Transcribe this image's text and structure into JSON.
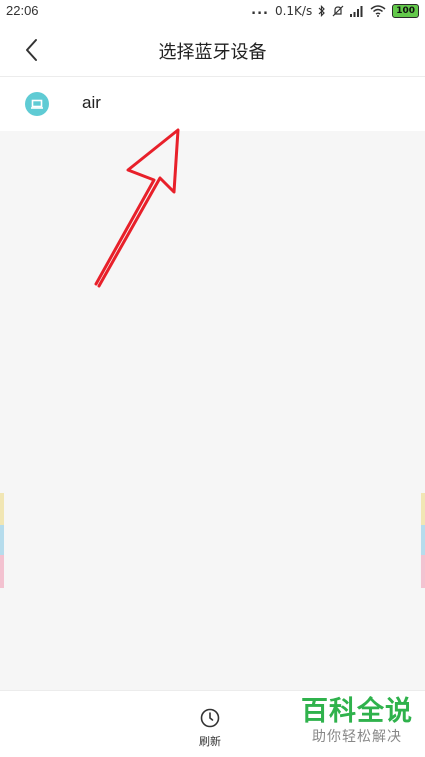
{
  "status_bar": {
    "time": "22:06",
    "dots": "...",
    "network_speed": "0.1K/s",
    "battery": "100",
    "icons": [
      "bluetooth-icon",
      "mute-icon",
      "signal-icon",
      "wifi-icon",
      "battery-icon"
    ]
  },
  "header": {
    "title": "选择蓝牙设备",
    "back_icon": "chevron-left-icon"
  },
  "devices": [
    {
      "name": "air",
      "icon": "laptop-icon",
      "icon_color": "#5fcbd4"
    }
  ],
  "annotation": {
    "color": "#e8202a",
    "icon": "red-arrow-annotation"
  },
  "bottom_bar": {
    "refresh_label": "刷新",
    "refresh_icon": "clock-icon"
  },
  "watermark": {
    "main": "百科全说",
    "sub": "助你轻松解决",
    "color": "#2fb24c"
  }
}
